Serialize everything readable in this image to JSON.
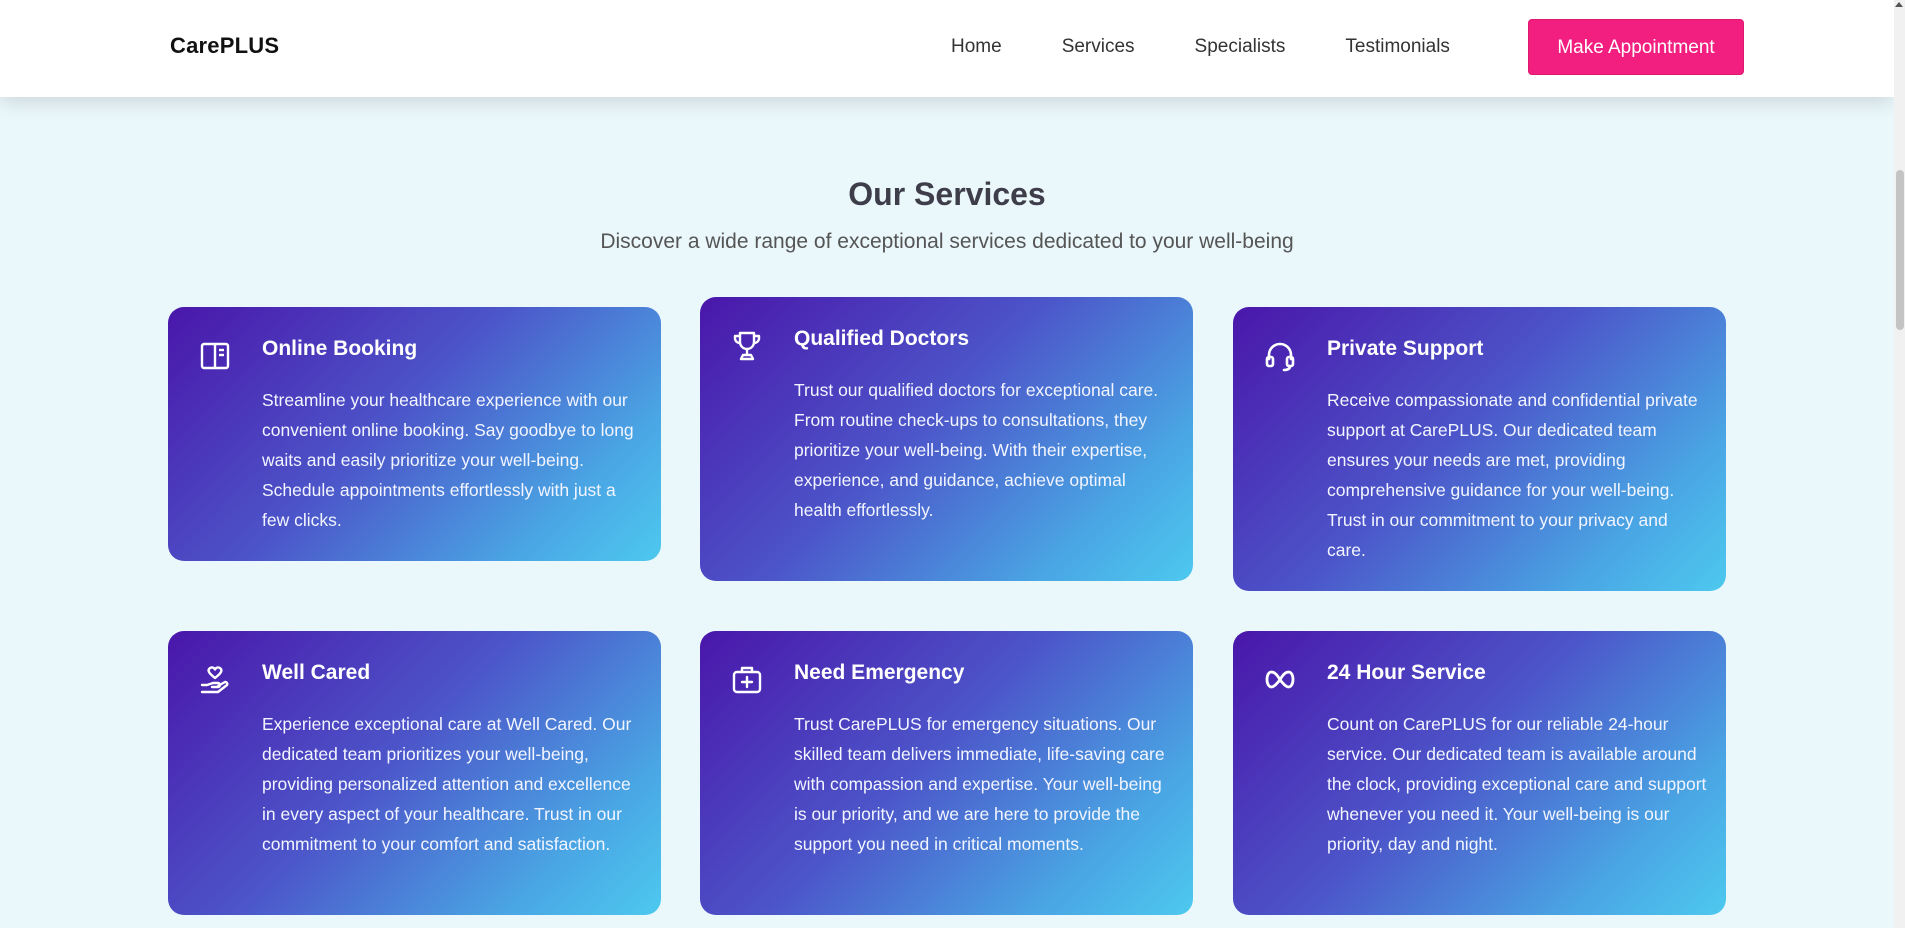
{
  "header": {
    "logo": "CarePLUS",
    "nav": [
      "Home",
      "Services",
      "Specialists",
      "Testimonials"
    ],
    "cta": "Make Appointment"
  },
  "services": {
    "title": "Our Services",
    "subtitle": "Discover a wide range of exceptional services dedicated to your well-being",
    "cards": [
      {
        "icon": "booking-icon",
        "title": "Online Booking",
        "desc": "Streamline your healthcare experience with our convenient online booking. Say goodbye to long waits and easily prioritize your well-being. Schedule appointments effortlessly with just a few clicks."
      },
      {
        "icon": "trophy-icon",
        "title": "Qualified Doctors",
        "desc": "Trust our qualified doctors for exceptional care. From routine check-ups to consultations, they prioritize your well-being. With their expertise, experience, and guidance, achieve optimal health effortlessly."
      },
      {
        "icon": "headset-icon",
        "title": "Private Support",
        "desc": "Receive compassionate and confidential private support at CarePLUS. Our dedicated team ensures your needs are met, providing comprehensive guidance for your well-being. Trust in our commitment to your privacy and care."
      },
      {
        "icon": "heart-hand-icon",
        "title": "Well Cared",
        "desc": "Experience exceptional care at Well Cared. Our dedicated team prioritizes your well-being, providing personalized attention and excellence in every aspect of your healthcare. Trust in our commitment to your comfort and satisfaction."
      },
      {
        "icon": "first-aid-kit-icon",
        "title": "Need Emergency",
        "desc": "Trust CarePLUS for emergency situations. Our skilled team delivers immediate, life-saving care with compassion and expertise. Your well-being is our priority, and we are here to provide the support you need in critical moments."
      },
      {
        "icon": "infinity-icon",
        "title": "24 Hour Service",
        "desc": "Count on CarePLUS for our reliable 24-hour service. Our dedicated team is available around the clock, providing exceptional care and support whenever you need it. Your well-being is our priority, day and night."
      }
    ]
  }
}
